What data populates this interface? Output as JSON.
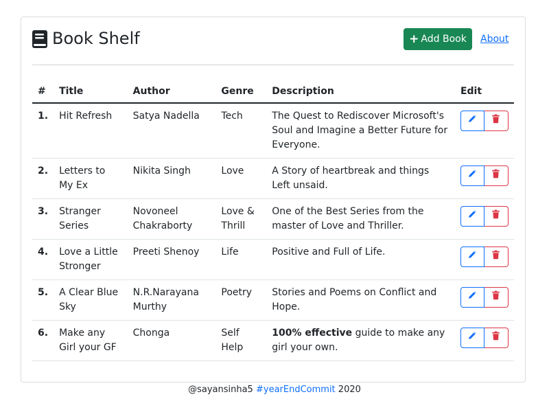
{
  "header": {
    "title": "Book Shelf",
    "add_button_label": "Add Book",
    "about_link": "About"
  },
  "table": {
    "columns": [
      "#",
      "Title",
      "Author",
      "Genre",
      "Description",
      "Edit"
    ],
    "rows": [
      {
        "num": "1.",
        "title": "Hit Refresh",
        "author": "Satya Nadella",
        "genre": "Tech",
        "desc_bold": "",
        "desc": "The Quest to Rediscover Microsoft's Soul and Imagine a Better Future for Everyone."
      },
      {
        "num": "2.",
        "title": "Letters to My Ex",
        "author": "Nikita Singh",
        "genre": "Love",
        "desc_bold": "",
        "desc": "A Story of heartbreak and things Left unsaid."
      },
      {
        "num": "3.",
        "title": "Stranger Series",
        "author": "Novoneel Chakraborty",
        "genre": "Love & Thrill",
        "desc_bold": "",
        "desc": "One of the Best Series from the master of Love and Thriller."
      },
      {
        "num": "4.",
        "title": "Love a Little Stronger",
        "author": "Preeti Shenoy",
        "genre": "Life",
        "desc_bold": "",
        "desc": "Positive and Full of Life."
      },
      {
        "num": "5.",
        "title": "A Clear Blue Sky",
        "author": "N.R.Narayana Murthy",
        "genre": "Poetry",
        "desc_bold": "",
        "desc": "Stories and Poems on Conflict and Hope."
      },
      {
        "num": "6.",
        "title": "Make any Girl your GF",
        "author": "Chonga",
        "genre": "Self Help",
        "desc_bold": "100% effective",
        "desc": " guide to make any girl your own."
      }
    ]
  },
  "footer": {
    "handle": "@sayansinha5",
    "hashtag": "#yearEndCommit",
    "year": "2020"
  },
  "colors": {
    "primary": "#0d6efd",
    "success": "#198754",
    "danger": "#dc3545",
    "text": "#212529"
  },
  "icons": {
    "brand": "book-icon",
    "add": "plus-icon",
    "edit": "pencil-icon",
    "delete": "trash-icon"
  }
}
